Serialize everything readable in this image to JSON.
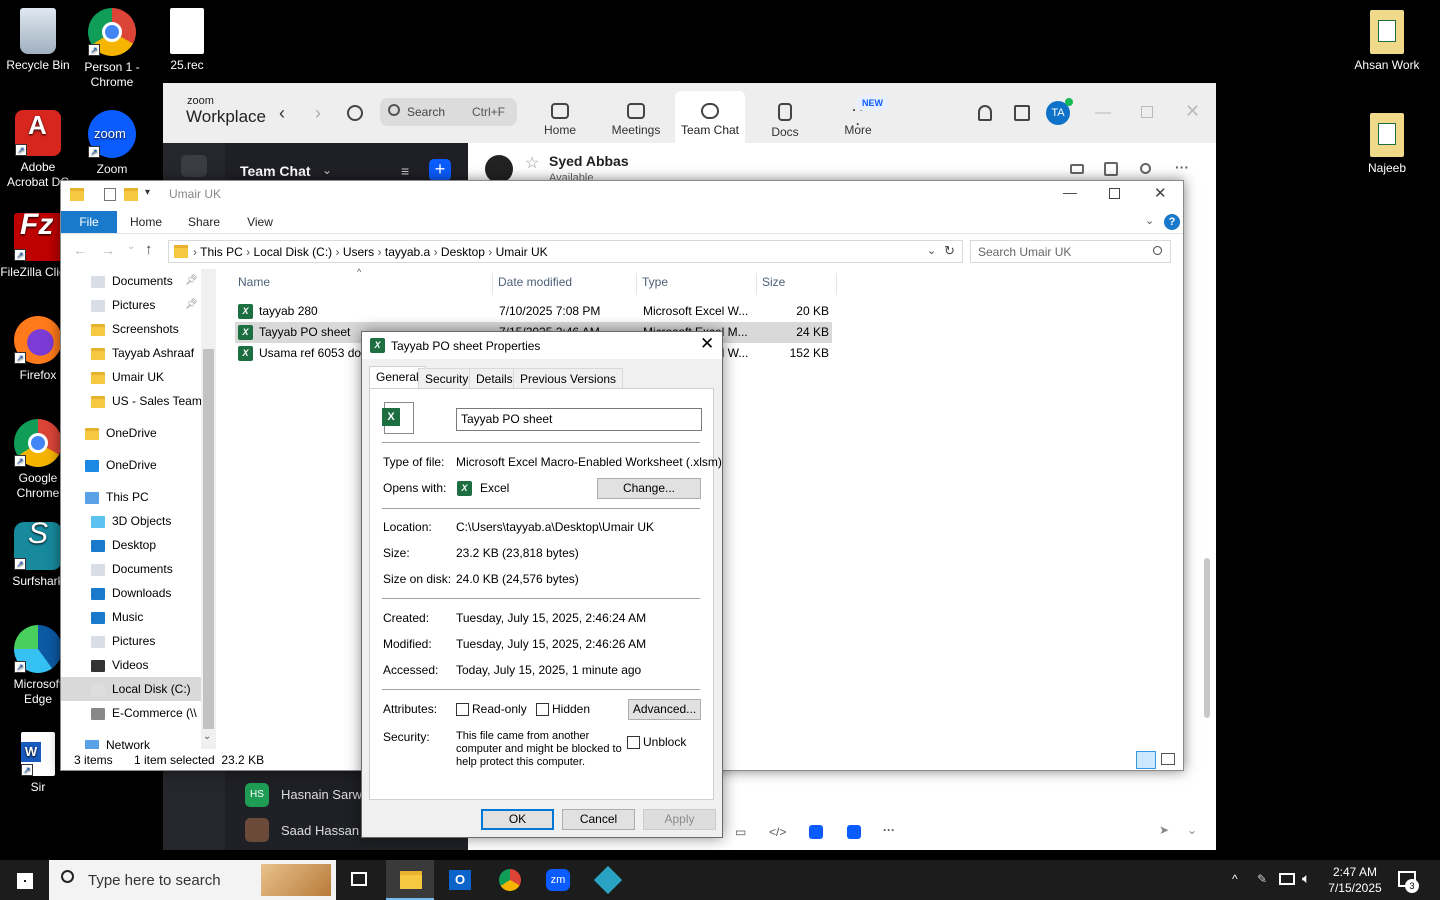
{
  "desktop": {
    "left_icons": [
      {
        "label": "Recycle Bin"
      },
      {
        "label": "Person 1 - Chrome"
      },
      {
        "label": "25.rec"
      },
      {
        "label": "Adobe Acrobat DC"
      },
      {
        "label": "Zoom"
      },
      {
        "label": "FileZilla Client"
      },
      {
        "label": "Firefox"
      },
      {
        "label": "Google Chrome"
      },
      {
        "label": "Surfshark"
      },
      {
        "label": "Microsoft Edge"
      },
      {
        "label": "Sir"
      }
    ],
    "right_icons": [
      {
        "label": "Ahsan Work"
      },
      {
        "label": "Najeeb"
      }
    ]
  },
  "zoom": {
    "brand_top": "zoom",
    "brand_bottom": "Workplace",
    "search_placeholder": "Search",
    "search_shortcut": "Ctrl+F",
    "tabs": [
      {
        "label": "Home"
      },
      {
        "label": "Meetings"
      },
      {
        "label": "Team Chat"
      },
      {
        "label": "Docs"
      },
      {
        "label": "More"
      }
    ],
    "new_badge": "NEW",
    "avatar_initials": "TA",
    "left_title": "Team Chat",
    "contact_name": "Syed Abbas",
    "contact_status": "Available",
    "chat_list": [
      {
        "initials": "HS",
        "name": "Hasnain Sarwar"
      },
      {
        "initials": "",
        "name": "Saad Hassan"
      }
    ],
    "accent": "#0b5cff"
  },
  "explorer": {
    "title": "Umair UK",
    "ribbon": {
      "file": "File",
      "home": "Home",
      "share": "Share",
      "view": "View"
    },
    "breadcrumb": [
      "This PC",
      "Local Disk (C:)",
      "Users",
      "tayyab.a",
      "Desktop",
      "Umair UK"
    ],
    "search_placeholder": "Search Umair UK",
    "nav": [
      {
        "label": "Documents",
        "pinned": true
      },
      {
        "label": "Pictures",
        "pinned": true
      },
      {
        "label": "Screenshots"
      },
      {
        "label": "Tayyab Ashraaf"
      },
      {
        "label": "Umair UK"
      },
      {
        "label": "US - Sales Team"
      },
      {
        "label": "OneDrive"
      },
      {
        "label": "OneDrive"
      },
      {
        "label": "This PC"
      },
      {
        "label": "3D Objects"
      },
      {
        "label": "Desktop"
      },
      {
        "label": "Documents"
      },
      {
        "label": "Downloads"
      },
      {
        "label": "Music"
      },
      {
        "label": "Pictures"
      },
      {
        "label": "Videos"
      },
      {
        "label": "Local Disk (C:)"
      },
      {
        "label": "E-Commerce (\\\\"
      },
      {
        "label": "Network"
      }
    ],
    "columns": {
      "name": "Name",
      "date": "Date modified",
      "type": "Type",
      "size": "Size"
    },
    "files": [
      {
        "name": "tayyab 280",
        "date": "7/10/2025 7:08 PM",
        "type": "Microsoft Excel W...",
        "size": "20 KB"
      },
      {
        "name": "Tayyab PO sheet",
        "date": "7/15/2025 2:46 AM",
        "type": "Microsoft Excel M...",
        "size": "24 KB"
      },
      {
        "name": "Usama ref 6053 done",
        "date": "",
        "type": "Microsoft Excel W...",
        "size": "152 KB"
      }
    ],
    "status_items": "3 items",
    "status_selected": "1 item selected  23.2 KB"
  },
  "dialog": {
    "title": "Tayyab PO sheet Properties",
    "tabs": [
      "General",
      "Security",
      "Details",
      "Previous Versions"
    ],
    "filename": "Tayyab PO sheet",
    "type_label": "Type of file:",
    "type_value": "Microsoft Excel Macro-Enabled Worksheet (.xlsm)",
    "opens_label": "Opens with:",
    "opens_value": "Excel",
    "change_button": "Change...",
    "location_label": "Location:",
    "location_value": "C:\\Users\\tayyab.a\\Desktop\\Umair UK",
    "size_label": "Size:",
    "size_value": "23.2 KB (23,818 bytes)",
    "size_disk_label": "Size on disk:",
    "size_disk_value": "24.0 KB (24,576 bytes)",
    "created_label": "Created:",
    "created_value": "Tuesday, July 15, 2025, 2:46:24 AM",
    "modified_label": "Modified:",
    "modified_value": "Tuesday, July 15, 2025, 2:46:26 AM",
    "accessed_label": "Accessed:",
    "accessed_value": "Today, July 15, 2025, 1 minute ago",
    "attributes_label": "Attributes:",
    "readonly_label": "Read-only",
    "hidden_label": "Hidden",
    "advanced_button": "Advanced...",
    "security_label": "Security:",
    "security_text": "This file came from another computer and might be blocked to help protect this computer.",
    "unblock_label": "Unblock",
    "ok_button": "OK",
    "cancel_button": "Cancel",
    "apply_button": "Apply"
  },
  "taskbar": {
    "search_placeholder": "Type here to search",
    "time": "2:47 AM",
    "date": "7/15/2025",
    "notification_count": "3"
  }
}
